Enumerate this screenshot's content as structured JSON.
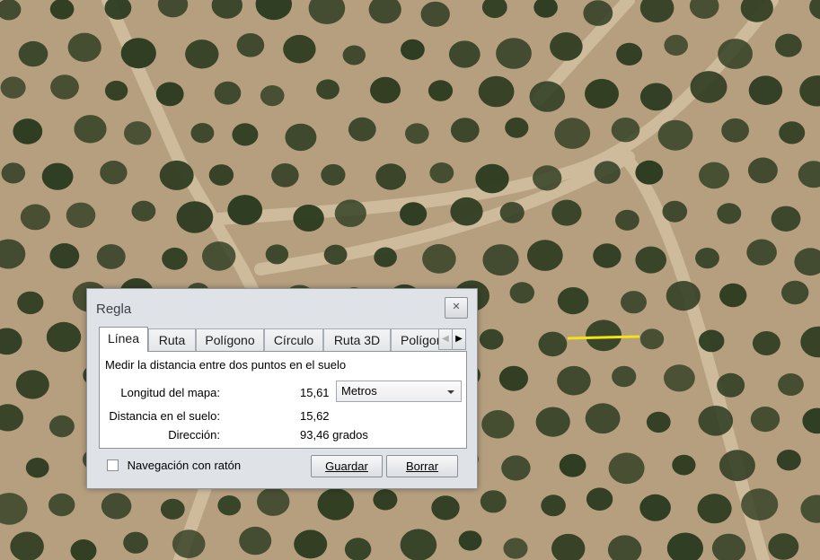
{
  "map": {
    "measure_line_color": "#f1e21a",
    "ground_color": "#b59f7e",
    "tree_color": "#2f3d22",
    "path_color": "#cdbb9b"
  },
  "dialog": {
    "title": "Regla",
    "close_icon": "close-icon",
    "tabs": [
      "Línea",
      "Ruta",
      "Polígono",
      "Círculo",
      "Ruta 3D",
      "Polígono"
    ],
    "active_tab": "Línea",
    "description": "Medir la distancia entre dos puntos en el suelo",
    "map_length_label": "Longitud del mapa:",
    "map_length_value": "15,61",
    "unit_selected": "Metros",
    "ground_distance_label": "Distancia en el suelo:",
    "ground_distance_value": "15,62",
    "direction_label": "Dirección:",
    "direction_value": "93,46 grados",
    "mouse_nav_label": "Navegación con ratón",
    "mouse_nav_checked": false,
    "save_label": "Guardar",
    "clear_label": "Borrar"
  }
}
